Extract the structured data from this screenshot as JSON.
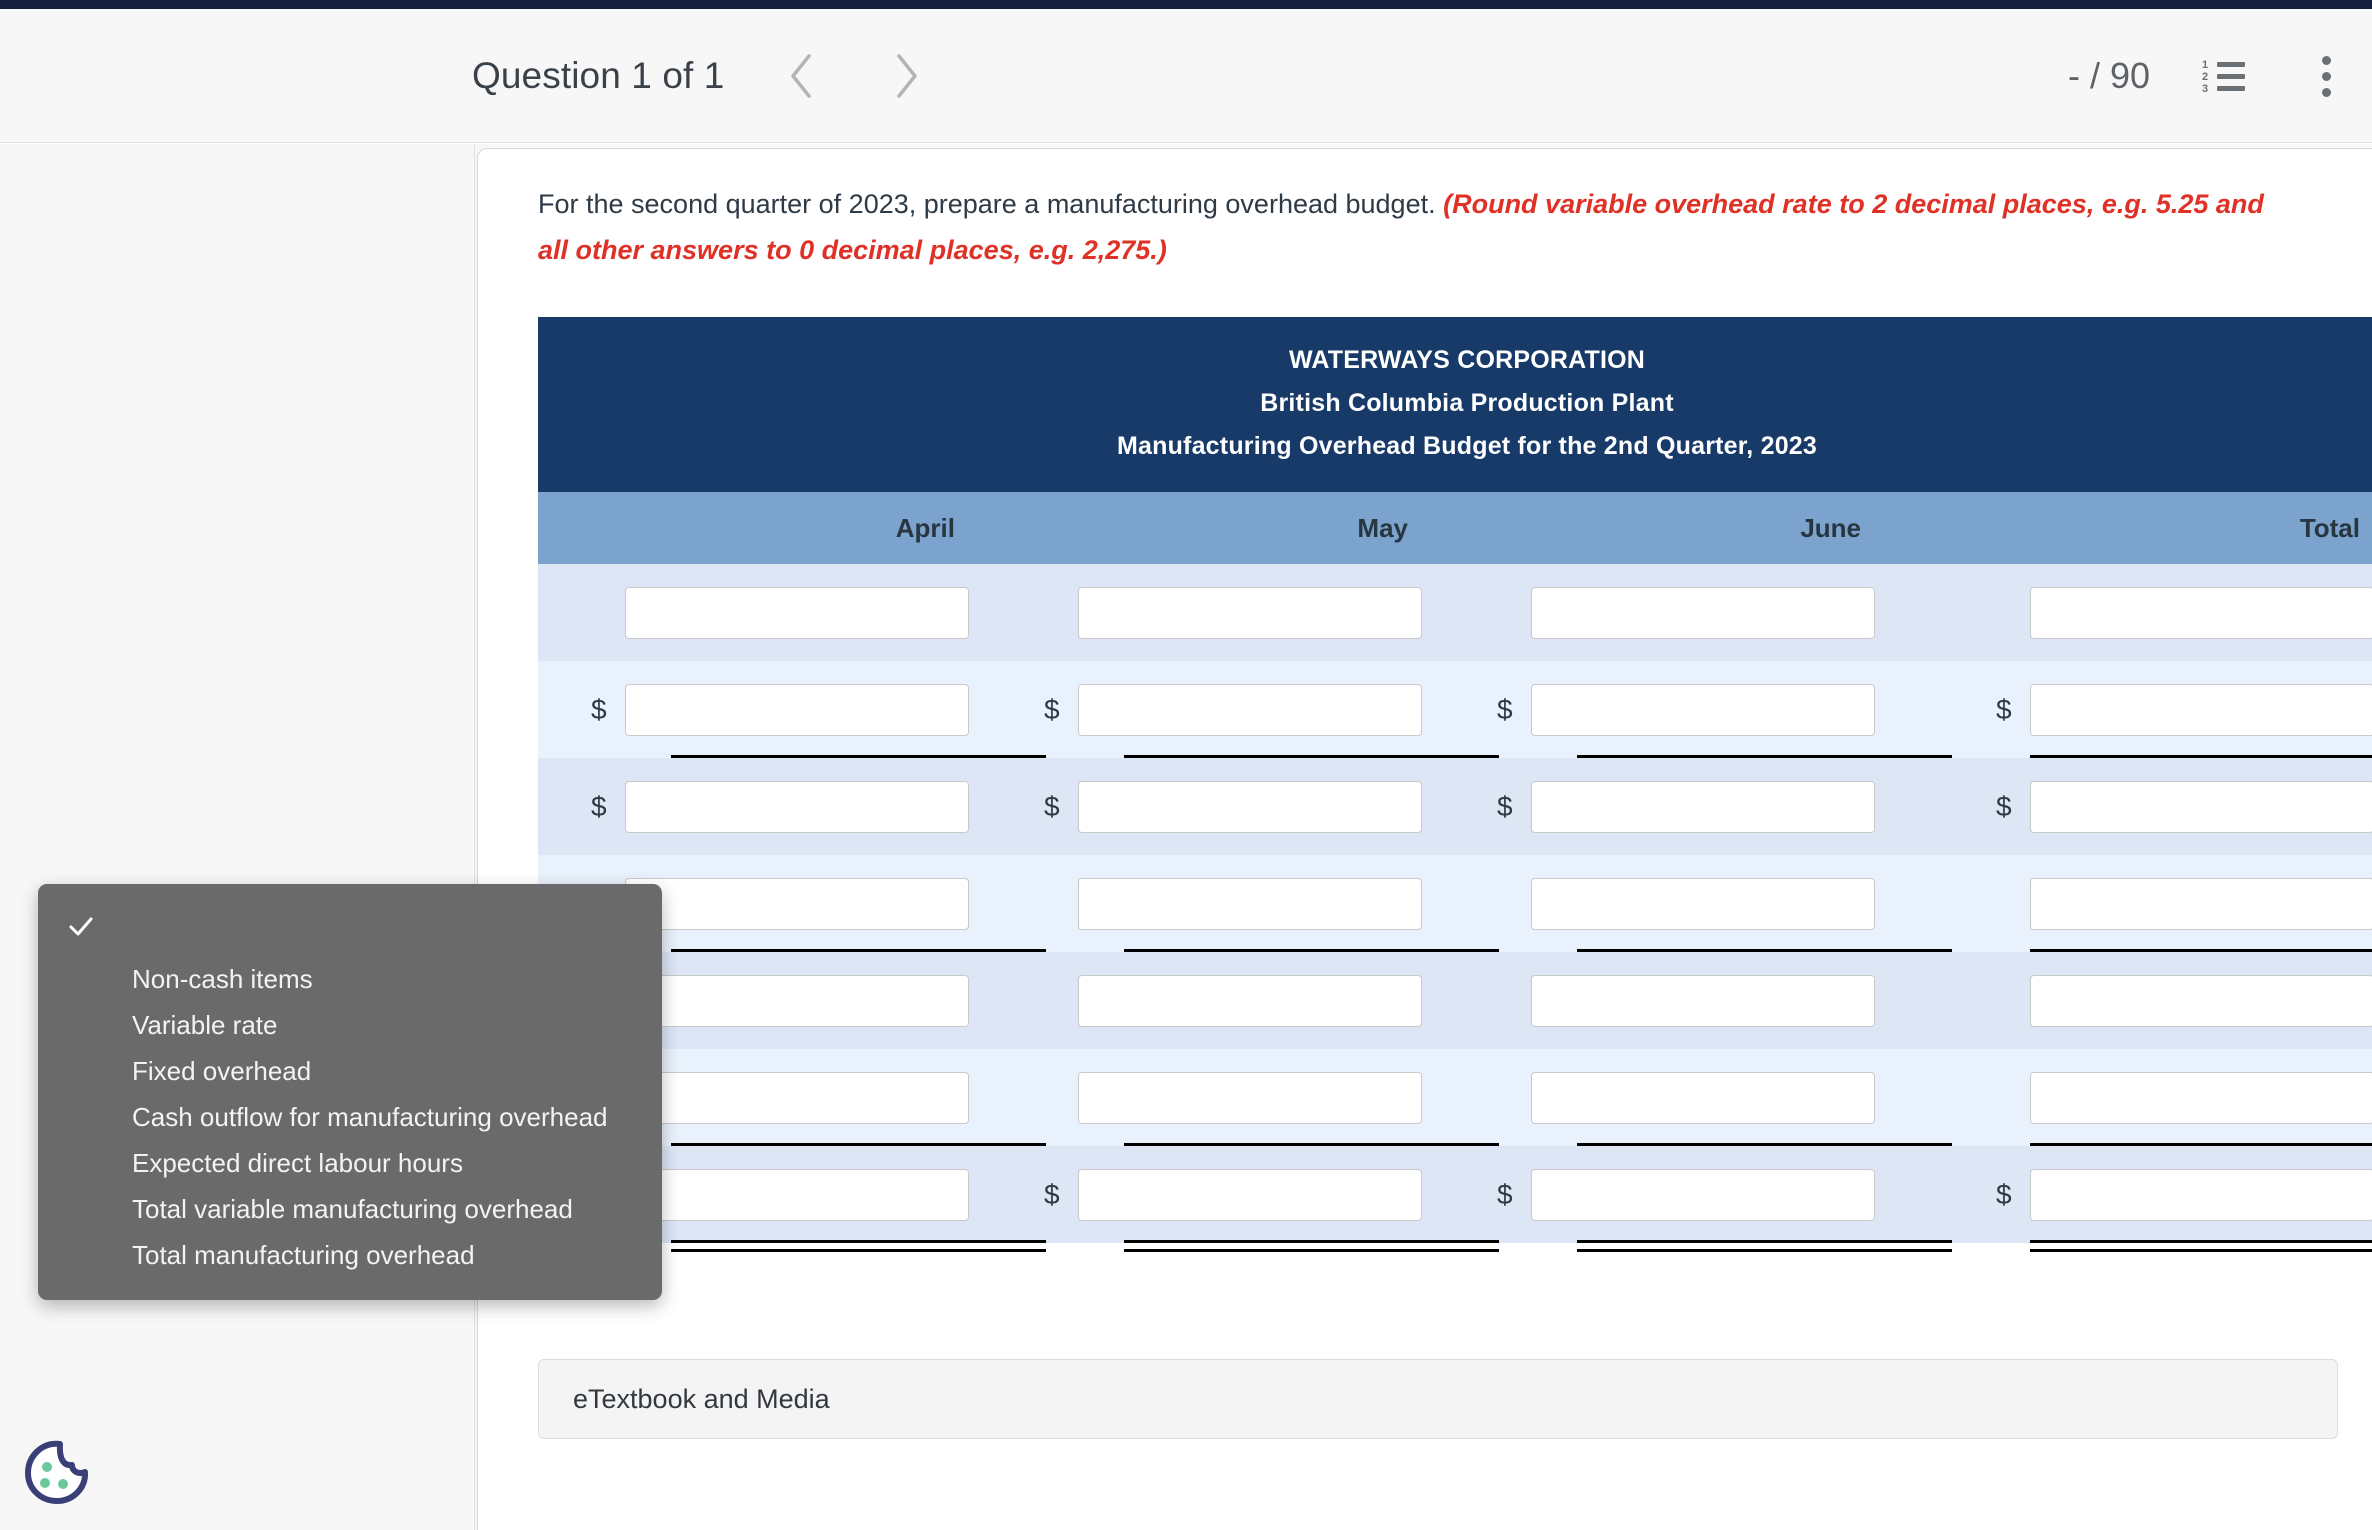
{
  "header": {
    "question_label": "Question 1 of 1",
    "prev_icon": "chevron-left-icon",
    "next_icon": "chevron-right-icon",
    "score": "- / 90",
    "list_icon": "numbered-list-icon",
    "menu_icon": "kebab-menu-icon"
  },
  "prompt": {
    "normal": "For the second quarter of 2023, prepare a manufacturing overhead budget. ",
    "emphasis": "(Round variable overhead rate to 2 decimal places, e.g. 5.25 and all other answers to 0 decimal places, e.g. 2,275.)"
  },
  "table": {
    "title_line1": "WATERWAYS CORPORATION",
    "title_line2": "British Columbia Production Plant",
    "title_line3": "Manufacturing Overhead Budget for the 2nd Quarter, 2023",
    "columns": [
      "April",
      "May",
      "June",
      "Total"
    ],
    "rows": [
      {
        "dollar": false,
        "rule": "none",
        "values": [
          "",
          "",
          "",
          ""
        ]
      },
      {
        "dollar": true,
        "rule": "single",
        "values": [
          "",
          "",
          "",
          ""
        ]
      },
      {
        "dollar": true,
        "rule": "none",
        "values": [
          "",
          "",
          "",
          ""
        ]
      },
      {
        "dollar": false,
        "rule": "single",
        "values": [
          "",
          "",
          "",
          ""
        ]
      },
      {
        "dollar": false,
        "rule": "none",
        "values": [
          "",
          "",
          "",
          ""
        ]
      },
      {
        "dollar": false,
        "rule": "single",
        "values": [
          "",
          "",
          "",
          ""
        ]
      },
      {
        "dollar": true,
        "rule": "double",
        "values": [
          "",
          "",
          "",
          ""
        ]
      }
    ]
  },
  "etextbook": {
    "label": "eTextbook and Media"
  },
  "dropdown": {
    "check_icon": "checkmark-icon",
    "items": [
      "Non-cash items",
      "Variable rate",
      "Fixed overhead",
      "Cash outflow for manufacturing overhead",
      "Expected direct labour hours",
      "Total variable manufacturing overhead",
      "Total manufacturing overhead"
    ]
  },
  "cookie": {
    "icon": "cookie-icon",
    "outline_color": "#3b3f77",
    "dot_color": "#6cc79a"
  },
  "colors": {
    "accent_bar": "#141f3f",
    "table_title_bg": "#173a68",
    "table_colhead_bg": "#7ba3cd",
    "row_odd": "#dde6f5",
    "row_even": "#e9f1fc",
    "emphasis_text": "#e03127",
    "dropdown_bg": "#6a6a6a"
  }
}
